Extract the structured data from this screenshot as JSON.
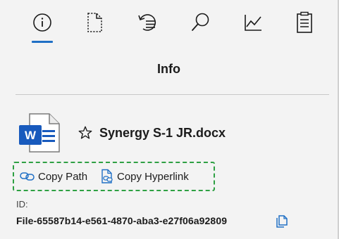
{
  "tabs": [
    {
      "name": "info",
      "icon": "info-icon",
      "selected": true
    },
    {
      "name": "page",
      "icon": "page-outline-icon",
      "selected": false
    },
    {
      "name": "history",
      "icon": "history-list-icon",
      "selected": false
    },
    {
      "name": "search",
      "icon": "search-icon",
      "selected": false
    },
    {
      "name": "analytics",
      "icon": "line-chart-icon",
      "selected": false
    },
    {
      "name": "notes",
      "icon": "clipboard-icon",
      "selected": false
    }
  ],
  "panel": {
    "title": "Info"
  },
  "file": {
    "icon": "word-document-icon",
    "icon_letter": "W",
    "name": "Synergy S-1 JR.docx",
    "favorite_icon": "star-outline-icon"
  },
  "actions": {
    "copy_path_label": "Copy Path",
    "copy_path_icon": "link-icon",
    "copy_hyperlink_label": "Copy Hyperlink",
    "copy_hyperlink_icon": "document-link-icon"
  },
  "id": {
    "label": "ID:",
    "value": "File-65587b14-e561-4870-aba3-e27f06a92809",
    "copy_icon": "copy-icon"
  },
  "colors": {
    "accent": "#1f6fc5",
    "word_blue": "#185abd",
    "dashed_highlight": "#2ea043",
    "background": "#f3f3f3"
  }
}
